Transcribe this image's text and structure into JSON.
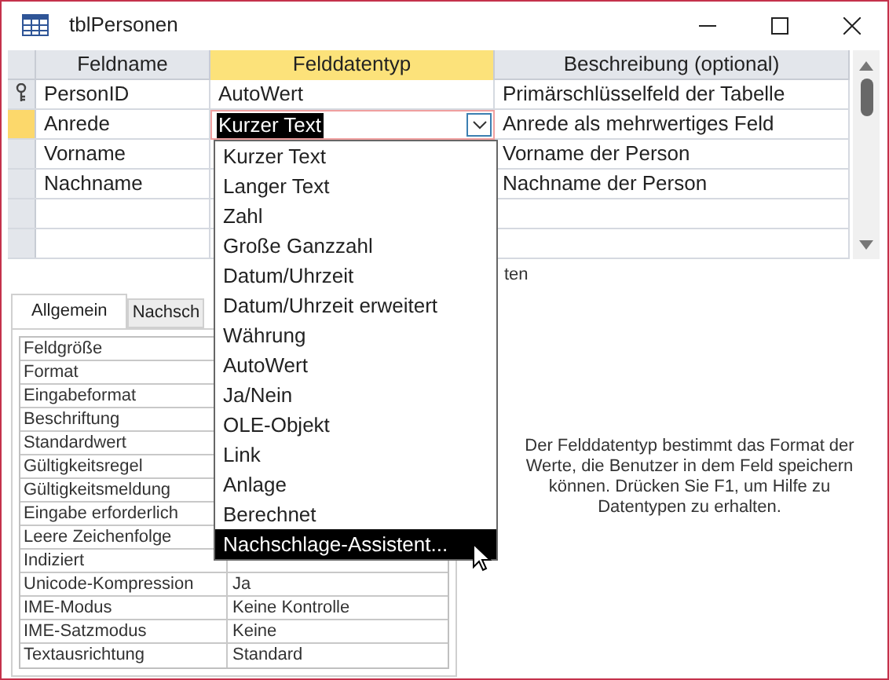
{
  "window": {
    "title": "tblPersonen"
  },
  "grid": {
    "columns": [
      "Feldname",
      "Felddatentyp",
      "Beschreibung (optional)"
    ],
    "rows": [
      {
        "field_name": "PersonID",
        "data_type": "AutoWert",
        "description": "Primärschlüsselfeld der Tabelle",
        "primary_key": true,
        "selected": false,
        "editing": false
      },
      {
        "field_name": "Anrede",
        "data_type": "Kurzer Text",
        "description": "Anrede als mehrwertiges Feld",
        "primary_key": false,
        "selected": true,
        "editing": true
      },
      {
        "field_name": "Vorname",
        "description": "Vorname der Person",
        "primary_key": false,
        "selected": false
      },
      {
        "field_name": "Nachname",
        "description": "Nachname der Person",
        "primary_key": false,
        "selected": false
      }
    ]
  },
  "dropdown": {
    "items": [
      {
        "label": "Kurzer Text",
        "selected": false
      },
      {
        "label": "Langer Text",
        "selected": false
      },
      {
        "label": "Zahl",
        "selected": false
      },
      {
        "label": "Große Ganzzahl",
        "selected": false
      },
      {
        "label": "Datum/Uhrzeit",
        "selected": false
      },
      {
        "label": "Datum/Uhrzeit erweitert",
        "selected": false
      },
      {
        "label": "Währung",
        "selected": false
      },
      {
        "label": "AutoWert",
        "selected": false
      },
      {
        "label": "Ja/Nein",
        "selected": false
      },
      {
        "label": "OLE-Objekt",
        "selected": false
      },
      {
        "label": "Link",
        "selected": false
      },
      {
        "label": "Anlage",
        "selected": false
      },
      {
        "label": "Berechnet",
        "selected": false
      },
      {
        "label": "Nachschlage-Assistent...",
        "selected": true
      }
    ]
  },
  "section_label": "ten",
  "properties": {
    "tabs": [
      {
        "label": "Allgemein",
        "selected": true
      },
      {
        "label": "Nachsch",
        "selected": false
      }
    ],
    "rows": [
      {
        "label": "Feldgröße"
      },
      {
        "label": "Format"
      },
      {
        "label": "Eingabeformat"
      },
      {
        "label": "Beschriftung"
      },
      {
        "label": "Standardwert"
      },
      {
        "label": "Gültigkeitsregel"
      },
      {
        "label": "Gültigkeitsmeldung"
      },
      {
        "label": "Eingabe erforderlich"
      },
      {
        "label": "Leere Zeichenfolge"
      },
      {
        "label": "Indiziert"
      },
      {
        "label": "Unicode-Kompression",
        "value": "Ja"
      },
      {
        "label": "IME-Modus",
        "value": "Keine Kontrolle"
      },
      {
        "label": "IME-Satzmodus",
        "value": "Keine"
      },
      {
        "label": "Textausrichtung",
        "value": "Standard"
      }
    ]
  },
  "help_text": "Der Felddatentyp bestimmt das Format der Werte, die Benutzer in dem Feld speichern können. Drücken Sie F1, um Hilfe zu Datentypen zu erhalten."
}
